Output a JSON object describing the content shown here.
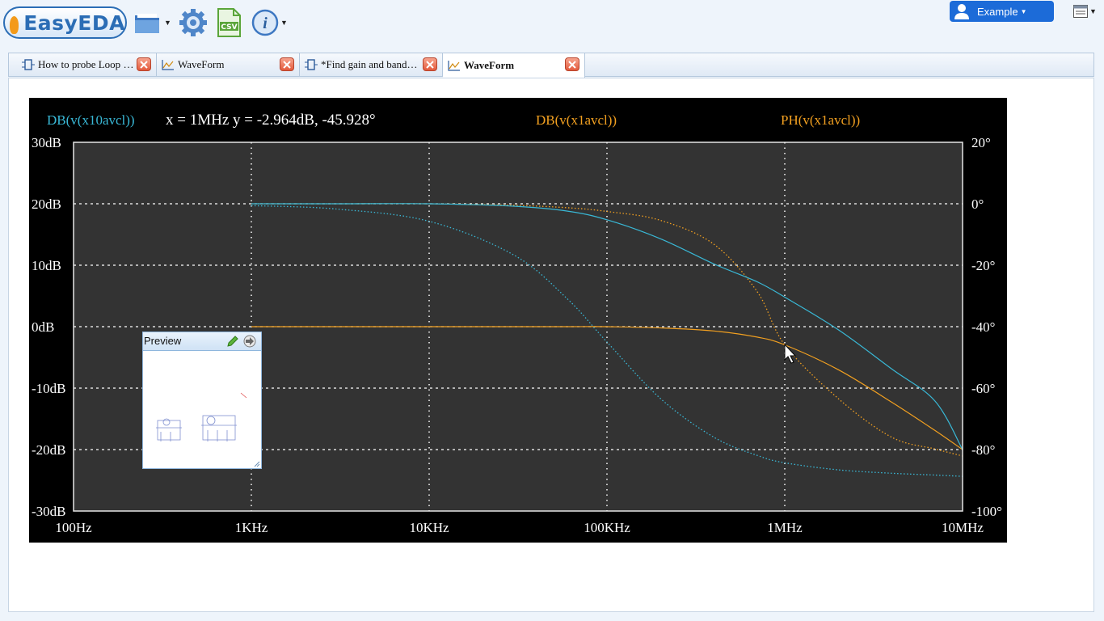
{
  "toolbar": {
    "logo_text": "EasyEDA",
    "user_label": "Example"
  },
  "tabs": [
    {
      "label": "How to probe Loop G…",
      "icon": "schematic-icon",
      "active": false
    },
    {
      "label": "WaveForm",
      "icon": "waveform-icon",
      "active": false
    },
    {
      "label": "*Find gain and band…",
      "icon": "schematic-icon",
      "active": false
    },
    {
      "label": "WaveForm",
      "icon": "waveform-icon",
      "active": true
    }
  ],
  "waveform": {
    "legend": {
      "series1": "DB(v(x10avcl))",
      "cursor_readout": "x = 1MHz y = -2.964dB, -45.928°",
      "series2": "DB(v(x1avcl))",
      "series3": "PH(v(x1avcl))"
    },
    "colors": {
      "background": "#000000",
      "plot_area": "#333333",
      "series1": "#39b8d6",
      "series2": "#f2a020",
      "series3": "#f2a020"
    }
  },
  "preview": {
    "title": "Preview"
  },
  "chart_data": {
    "type": "line",
    "xscale": "log",
    "xlim": [
      "100Hz",
      "10MHz"
    ],
    "x_ticks": [
      "100Hz",
      "1KHz",
      "10KHz",
      "100KHz",
      "1MHz",
      "10MHz"
    ],
    "y_left_ticks": [
      "30dB",
      "20dB",
      "10dB",
      "0dB",
      "-10dB",
      "-20dB",
      "-30dB"
    ],
    "y_right_ticks": [
      "20°",
      "0°",
      "-20°",
      "-40°",
      "-60°",
      "-80°",
      "-100°"
    ],
    "ylim_left": [
      -30,
      30
    ],
    "ylim_right": [
      -100,
      20
    ],
    "grid": true,
    "x_hz": [
      1000,
      3000,
      10000,
      30000,
      60000,
      100000,
      200000,
      400000,
      700000,
      1000000,
      2000000,
      4000000,
      7000000,
      10000000
    ],
    "series": [
      {
        "name": "DB(v(x10avcl))",
        "axis": "left",
        "style": "solid",
        "color": "#39b8d6",
        "values": [
          20,
          20,
          20,
          19.6,
          18.8,
          17.4,
          14.3,
          10.2,
          7.3,
          4.8,
          -0.5,
          -6.9,
          -12.1,
          -20
        ]
      },
      {
        "name": "PH(v(x10avcl))",
        "axis": "right",
        "style": "dotted",
        "color": "#39b8d6",
        "values": [
          -0.6,
          -1.7,
          -5.7,
          -16.7,
          -31,
          -45,
          -63.4,
          -76,
          -81.9,
          -84.3,
          -86.6,
          -87.7,
          -88.3,
          -88.7
        ]
      },
      {
        "name": "DB(v(x1avcl))",
        "axis": "left",
        "style": "solid",
        "color": "#f2a020",
        "values": [
          0,
          0,
          0,
          0,
          0,
          0,
          -0.2,
          -0.7,
          -1.7,
          -2.964,
          -7,
          -12.3,
          -16.9,
          -20
        ]
      },
      {
        "name": "PH(v(x1avcl))",
        "axis": "right",
        "style": "dotted",
        "color": "#f2a020",
        "values": [
          0,
          0,
          0,
          -0.5,
          -1.3,
          -2.5,
          -5.4,
          -13.2,
          -28.6,
          -45.928,
          -63.4,
          -76,
          -79.8,
          -82.1
        ]
      }
    ]
  }
}
